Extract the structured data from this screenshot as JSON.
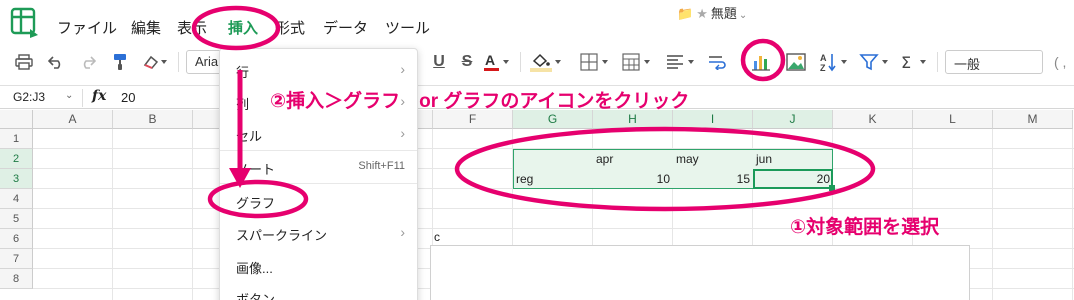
{
  "menubar": {
    "items": [
      "ファイル",
      "編集",
      "表示",
      "挿入",
      "形式",
      "データ",
      "ツール"
    ]
  },
  "document": {
    "title": "無題"
  },
  "toolbar": {
    "font_name": "Aria",
    "number_format": "一般",
    "trailing_glyph": "( ,"
  },
  "formula_bar": {
    "name_box": "G2:J3",
    "fx_label": "fx",
    "value": "20"
  },
  "grid": {
    "columns": [
      "A",
      "B",
      "C",
      "D",
      "E",
      "F",
      "G",
      "H",
      "I",
      "J",
      "K",
      "L",
      "M"
    ],
    "rows": [
      "1",
      "2",
      "3",
      "4",
      "5",
      "6",
      "7",
      "8"
    ],
    "cells": {
      "H2": "apr",
      "I2": "may",
      "J2": "jun",
      "G3": "reg",
      "H3": "10",
      "I3": "15",
      "J3": "20",
      "E6": "c"
    }
  },
  "insert_menu": {
    "items": [
      {
        "label": "行",
        "submenu": true
      },
      {
        "label": "列",
        "submenu": true
      },
      {
        "label": "セル",
        "submenu": true
      },
      {
        "label": "ノート",
        "shortcut": "Shift+F11"
      },
      {
        "label": "グラフ"
      },
      {
        "label": "スパークライン",
        "submenu": true
      },
      {
        "label": "画像..."
      },
      {
        "label": "ボタン"
      }
    ]
  },
  "annotations": {
    "step2": "②挿入＞グラフ　or グラフのアイコンをクリック",
    "step1": "①対象範囲を選択",
    "color": "#e6006e"
  },
  "colors": {
    "accent_green": "#1b9a59",
    "selection_fill": "#e8f5ec",
    "annotation_pink": "#e6006e"
  }
}
